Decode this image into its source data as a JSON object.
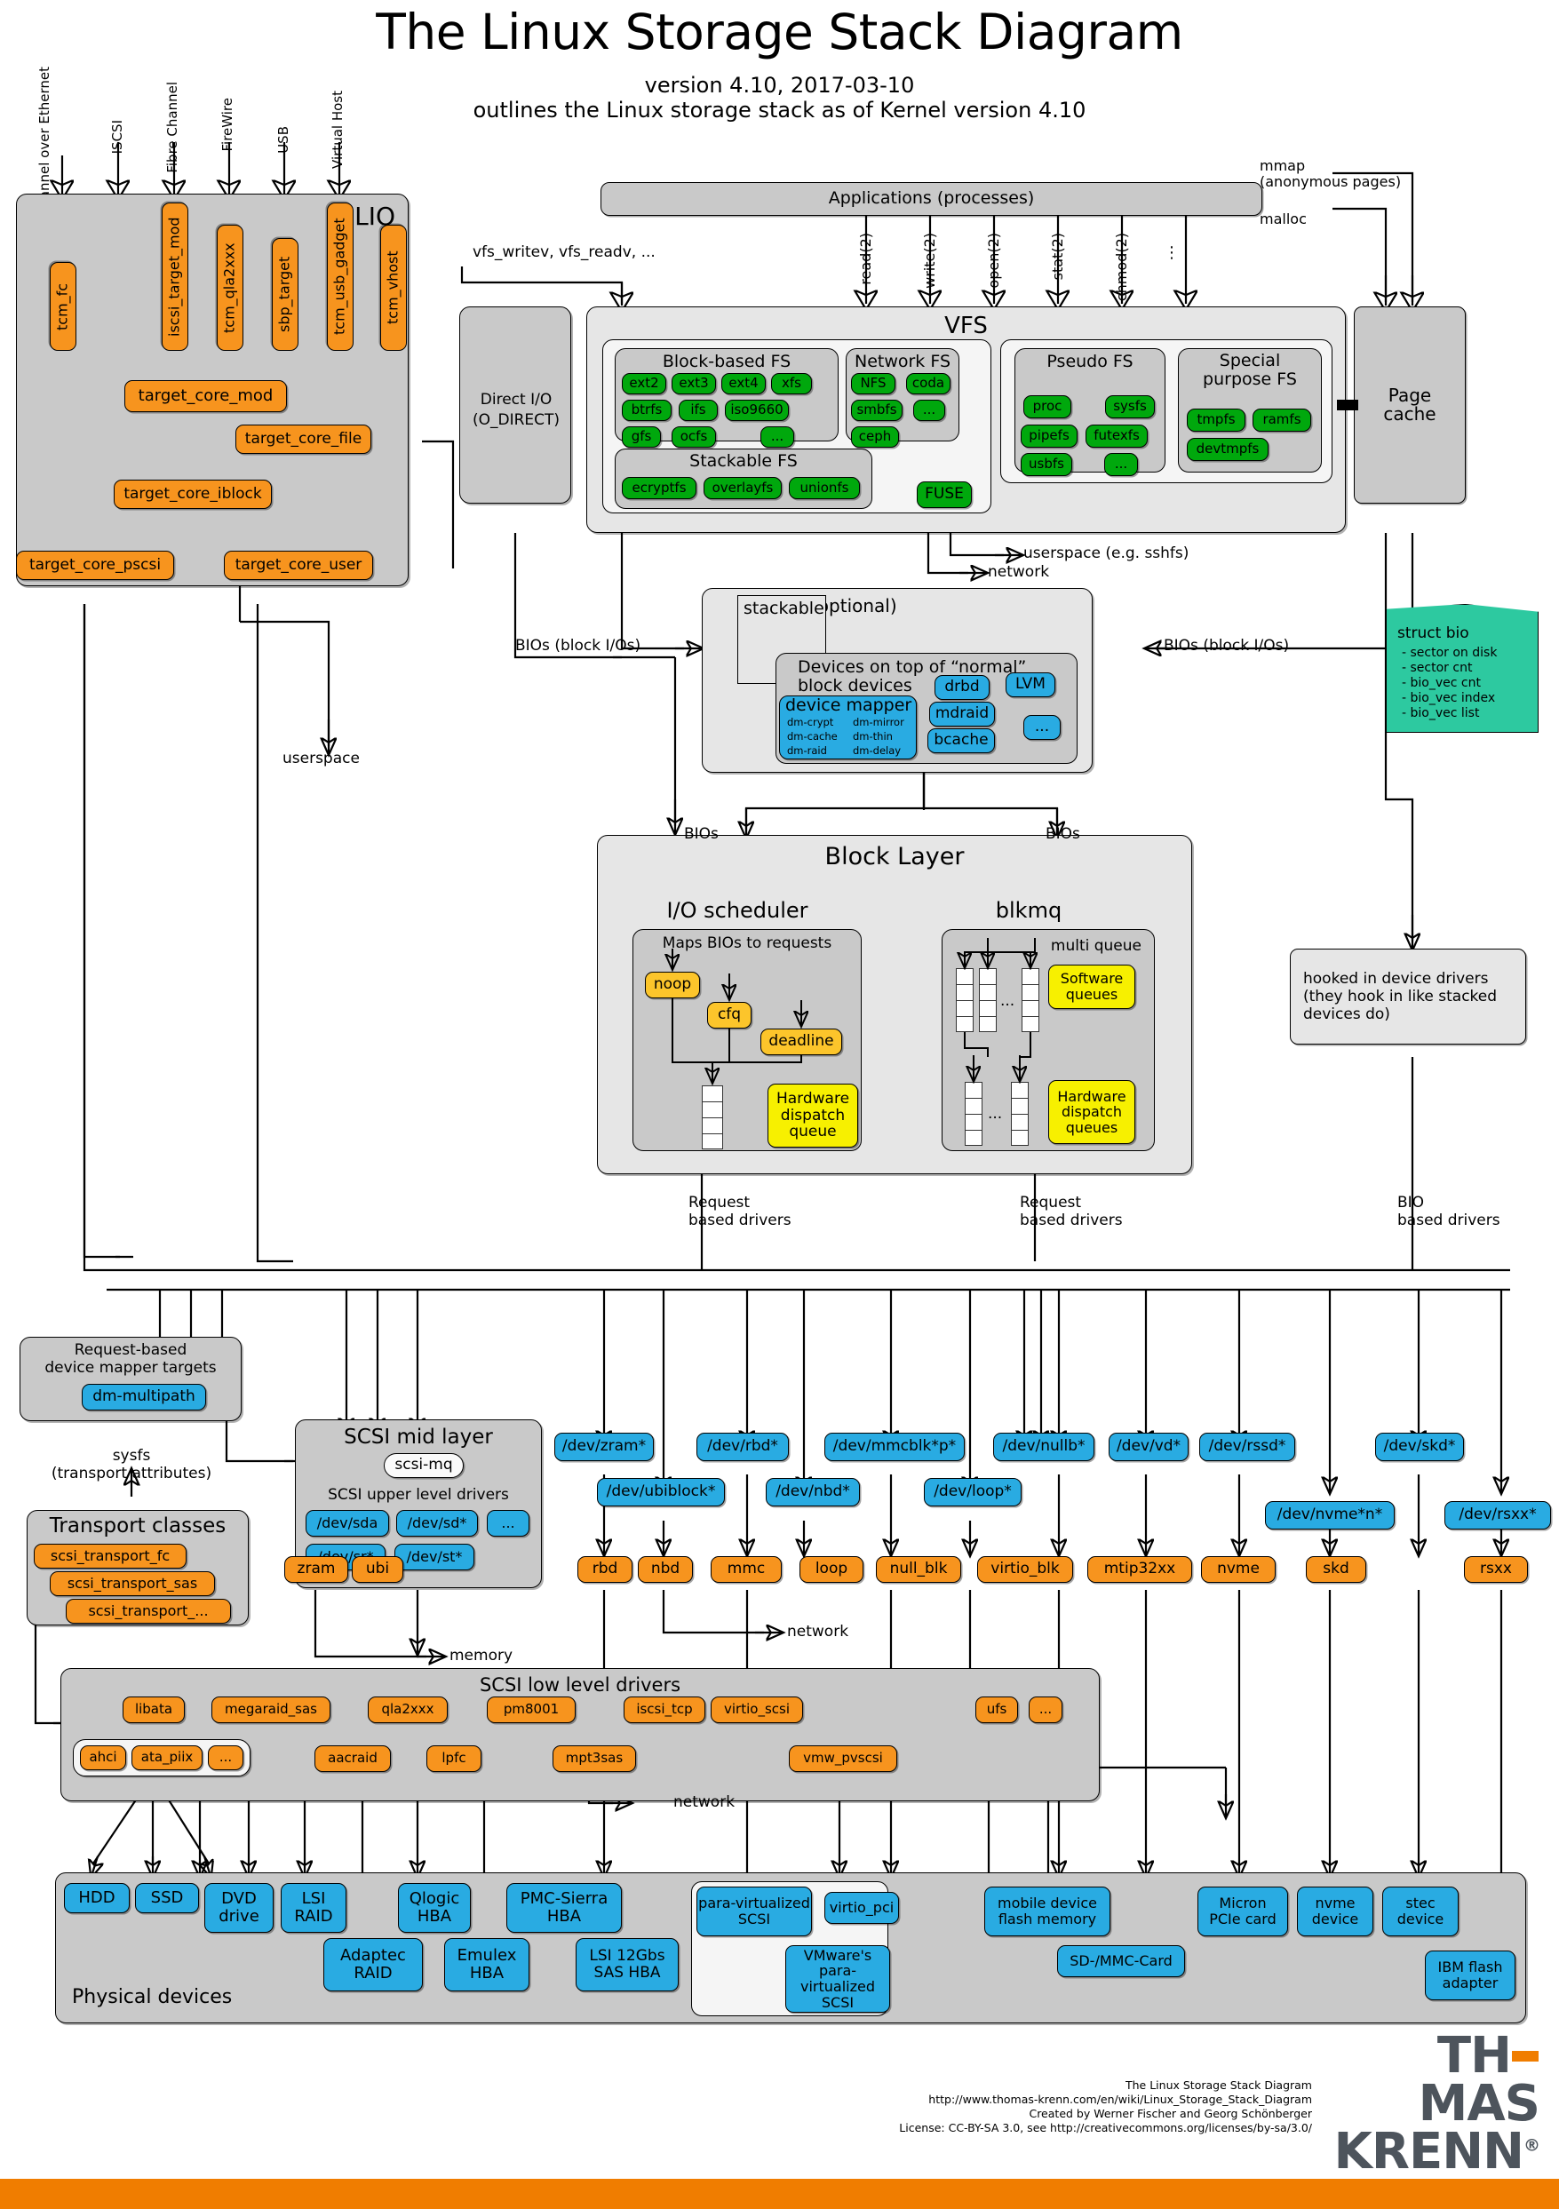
{
  "header": {
    "title": "The Linux Storage Stack Diagram",
    "subtitle1": "version 4.10, 2017-03-10",
    "subtitle2": "outlines the Linux storage stack as of Kernel version 4.10"
  },
  "lio": {
    "group_title": "LIO",
    "inbound_labels": [
      "Fibre Channel\nover Ethernet",
      "ISCSI",
      "Fibre Channel",
      "FireWire",
      "USB",
      "Virtual Host"
    ],
    "fabrics": [
      "tcm_fc",
      "iscsi_target_mod",
      "tcm_qla2xxx",
      "sbp_target",
      "tcm_usb_gadget",
      "tcm_vhost"
    ],
    "core": "target_core_mod",
    "backstores": [
      "target_core_file",
      "target_core_iblock",
      "target_core_pscsi",
      "target_core_user"
    ],
    "userspace_label": "userspace"
  },
  "apps": {
    "box_label": "Applications (processes)",
    "syscalls": [
      "read(2)",
      "write(2)",
      "open(2)",
      "stat(2)",
      "chmod(2)",
      "⋮"
    ],
    "vfs_helpers": "vfs_writev, vfs_readv, ...",
    "mmap_label": "mmap\n(anonymous pages)",
    "malloc_label": "malloc"
  },
  "direct_io": {
    "line1": "Direct I/O",
    "line2": "(O_DIRECT)"
  },
  "vfs": {
    "title": "VFS",
    "block_fs": {
      "title": "Block-based FS",
      "items": [
        "ext2",
        "ext3",
        "ext4",
        "xfs",
        "btrfs",
        "ifs",
        "iso9660",
        "gfs",
        "ocfs",
        "..."
      ]
    },
    "network_fs": {
      "title": "Network FS",
      "items": [
        "NFS",
        "coda",
        "smbfs",
        "...",
        "ceph"
      ]
    },
    "stackable_fs": {
      "title": "Stackable FS",
      "items": [
        "ecryptfs",
        "overlayfs",
        "unionfs"
      ]
    },
    "pseudo_fs": {
      "title": "Pseudo FS",
      "items": [
        "proc",
        "sysfs",
        "pipefs",
        "futexfs",
        "usbfs",
        "..."
      ]
    },
    "special_fs": {
      "title": "Special\npurpose FS",
      "items": [
        "tmpfs",
        "ramfs",
        "devtmpfs"
      ]
    },
    "fuse": "FUSE",
    "fuse_target": "userspace (e.g. sshfs)",
    "network_target": "network"
  },
  "page_cache": {
    "label": "Page\ncache"
  },
  "struct_bio": {
    "title": "struct bio",
    "fields": [
      "- sector on disk",
      "- sector cnt",
      "- bio_vec cnt",
      "- bio_vec index",
      "- bio_vec list"
    ]
  },
  "stacked": {
    "stackable_tag": "stackable",
    "optional_tag": "(optional)",
    "inner_title": "Devices on top of “normal”\nblock devices",
    "device_mapper": {
      "title": "device mapper",
      "targets": [
        "dm-crypt",
        "dm-mirror",
        "dm-cache",
        "dm-thin",
        "dm-raid",
        "dm-delay"
      ]
    },
    "others": [
      "drbd",
      "LVM",
      "mdraid",
      "bcache",
      "..."
    ],
    "bios_left": "BIOs (block I/Os)",
    "bios_right": "BIOs (block I/Os)"
  },
  "block_layer": {
    "title": "Block Layer",
    "bios_label": "BIOs",
    "io_scheduler": {
      "title": "I/O scheduler",
      "caption": "Maps BIOs to requests",
      "schedulers": [
        "noop",
        "cfq",
        "deadline"
      ],
      "dispatch": "Hardware\ndispatch\nqueue"
    },
    "blkmq": {
      "title": "blkmq",
      "caption": "multi queue",
      "software_queues": "Software\nqueues",
      "hardware_queues": "Hardware\ndispatch\nqueues",
      "ellipsis": "..."
    },
    "request_based_left": "Request\nbased drivers",
    "request_based_right": "Request\nbased drivers",
    "bio_based": "BIO\nbased drivers"
  },
  "hooked": {
    "label": "hooked in device drivers\n(they hook in like stacked\ndevices do)"
  },
  "dm_targets": {
    "title": "Request-based\ndevice mapper targets",
    "item": "dm-multipath"
  },
  "sysfs_note": "sysfs\n(transport attributes)",
  "transport_classes": {
    "title": "Transport classes",
    "items": [
      "scsi_transport_fc",
      "scsi_transport_sas",
      "scsi_transport_..."
    ]
  },
  "scsi_mid": {
    "title": "SCSI mid layer",
    "mq": "scsi-mq",
    "upper_title": "SCSI upper level drivers",
    "devices": [
      "/dev/sda",
      "/dev/sd*",
      "...",
      "/dev/sr*",
      "/dev/st*"
    ]
  },
  "dev_nodes_row1": [
    "/dev/zram*",
    "/dev/rbd*",
    "/dev/mmcblk*p*",
    "/dev/nullb*",
    "/dev/vd*",
    "/dev/rssd*",
    "/dev/skd*"
  ],
  "dev_nodes_row2": [
    "/dev/ubiblock*",
    "/dev/nbd*",
    "/dev/loop*",
    "/dev/nvme*n*",
    "/dev/rsxx*"
  ],
  "drivers_row": [
    "zram",
    "ubi",
    "rbd",
    "nbd",
    "mmc",
    "loop",
    "null_blk",
    "virtio_blk",
    "mtip32xx",
    "nvme",
    "skd",
    "rsxx"
  ],
  "driver_notes": {
    "memory": "memory",
    "network": "network"
  },
  "scsi_low": {
    "title": "SCSI low level drivers",
    "row1": [
      "libata",
      "megaraid_sas",
      "qla2xxx",
      "pm8001",
      "iscsi_tcp",
      "virtio_scsi",
      "ufs",
      "..."
    ],
    "libata_group": [
      "ahci",
      "ata_piix",
      "..."
    ],
    "row2": [
      "aacraid",
      "lpfc",
      "mpt3sas",
      "vmw_pvscsi"
    ],
    "network_label": "network"
  },
  "physical": {
    "title": "Physical devices",
    "row1": [
      "HDD",
      "SSD",
      "DVD\ndrive",
      "LSI\nRAID",
      "Qlogic\nHBA",
      "PMC-Sierra\nHBA"
    ],
    "row2": [
      "Adaptec\nRAID",
      "Emulex\nHBA",
      "LSI 12Gbs\nSAS HBA"
    ],
    "virt": {
      "a": "para-virtualized\nSCSI",
      "b": "VMware's\npara-virtualized\nSCSI",
      "c": "virtio_pci"
    },
    "flash": [
      "mobile device\nflash memory",
      "SD-/MMC-Card"
    ],
    "cards": [
      "Micron\nPCIe card",
      "nvme\ndevice",
      "stec\ndevice",
      "IBM flash\nadapter"
    ]
  },
  "footer": {
    "lines": [
      "The Linux Storage Stack Diagram",
      "http://www.thomas-krenn.com/en/wiki/Linux_Storage_Stack_Diagram",
      "Created by Werner Fischer and Georg Schönberger",
      "License: CC-BY-SA 3.0, see http://creativecommons.org/licenses/by-sa/3.0/"
    ],
    "brand_top_a": "TH",
    "brand_top_b": "MAS",
    "brand_bottom": "KRENN",
    "brand_reg": "®"
  },
  "colors": {
    "orange": "#f7941e",
    "blue": "#29abe2",
    "green": "#00a80d",
    "yellow": "#f7f000",
    "amber": "#fcc52b",
    "teal": "#2dc9a0",
    "grey": "#c9c9c9",
    "brand_orange": "#f07d00",
    "brand_dark": "#4d545c"
  }
}
